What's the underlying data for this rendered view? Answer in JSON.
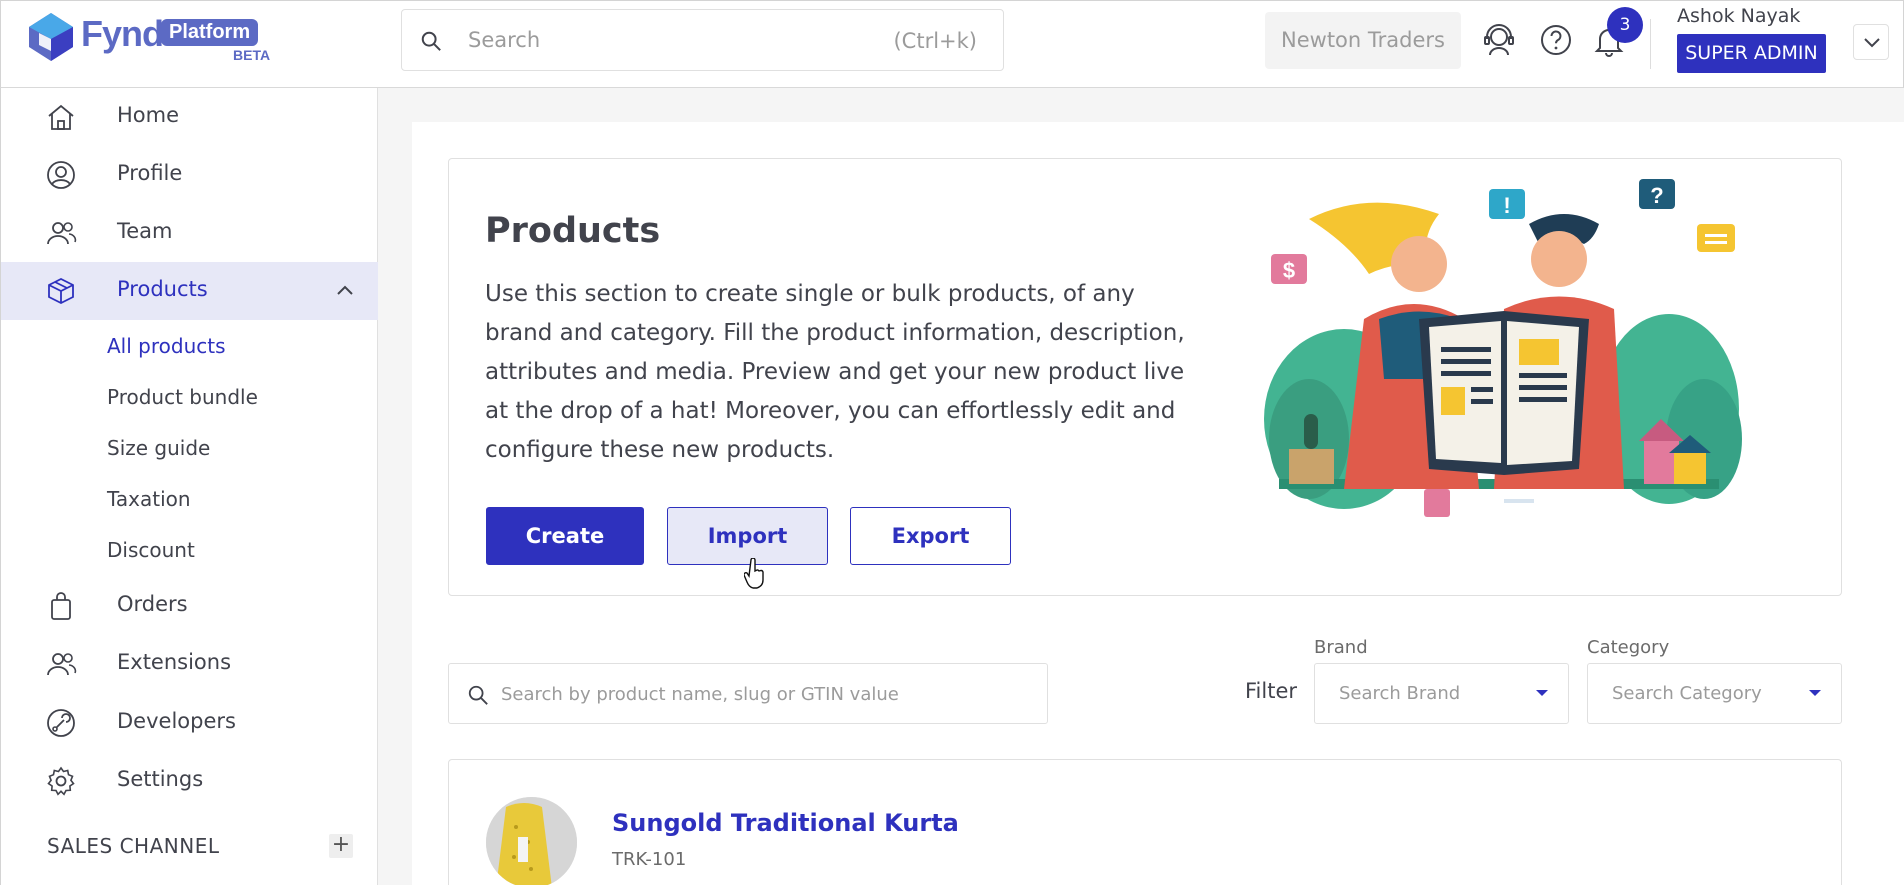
{
  "header": {
    "logo_text": "Fynd",
    "logo_badge": "Platform",
    "logo_beta": "BETA",
    "search_placeholder": "Search",
    "search_shortcut": "(Ctrl+k)",
    "company": "Newton Traders",
    "notification_count": "3",
    "user_name": "Ashok Nayak",
    "user_role": "SUPER ADMIN"
  },
  "sidebar": {
    "items": [
      {
        "label": "Home",
        "icon": "home-icon"
      },
      {
        "label": "Profile",
        "icon": "user-circle-icon"
      },
      {
        "label": "Team",
        "icon": "team-icon"
      },
      {
        "label": "Products",
        "icon": "box-icon"
      },
      {
        "label": "Orders",
        "icon": "shopping-bag-icon"
      },
      {
        "label": "Extensions",
        "icon": "extensions-icon"
      },
      {
        "label": "Developers",
        "icon": "developer-icon"
      },
      {
        "label": "Settings",
        "icon": "gear-icon"
      }
    ],
    "sub_items": [
      "All products",
      "Product bundle",
      "Size guide",
      "Taxation",
      "Discount"
    ],
    "sales_channel": "SALES CHANNEL"
  },
  "hero": {
    "title": "Products",
    "description": "Use this section to create single or bulk products, of any brand and category. Fill the product information, description, attributes and media. Preview and get your new product live at the drop of a hat! Moreover, you can effortlessly edit and configure these new products.",
    "create_label": "Create",
    "import_label": "Import",
    "export_label": "Export"
  },
  "filters": {
    "search_placeholder": "Search by product name, slug or GTIN value",
    "filter_label": "Filter",
    "brand_label": "Brand",
    "brand_placeholder": "Search Brand",
    "category_label": "Category",
    "category_placeholder": "Search Category"
  },
  "products": [
    {
      "name": "Sungold Traditional Kurta",
      "sku": "TRK-101"
    }
  ],
  "colors": {
    "primary": "#2e31be",
    "active_bg": "#e7e8f7",
    "brand": "#5c6ac4"
  }
}
